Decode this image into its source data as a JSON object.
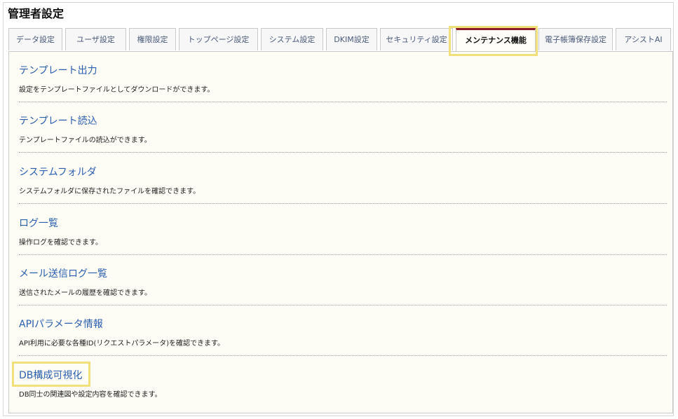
{
  "page": {
    "title": "管理者設定"
  },
  "tabs": [
    {
      "label": "データ設定"
    },
    {
      "label": "ユーザ設定"
    },
    {
      "label": "権限設定"
    },
    {
      "label": "トップページ設定"
    },
    {
      "label": "システム設定"
    },
    {
      "label": "DKIM設定"
    },
    {
      "label": "セキュリティ設定"
    },
    {
      "label": "メンテナンス機能"
    },
    {
      "label": "電子帳簿保存設定"
    },
    {
      "label": "アシストAI"
    }
  ],
  "active_tab": "メンテナンス機能",
  "items": [
    {
      "title": "テンプレート出力",
      "description": "設定をテンプレートファイルとしてダウンロードができます。"
    },
    {
      "title": "テンプレート読込",
      "description": "テンプレートファイルの読込ができます。"
    },
    {
      "title": "システムフォルダ",
      "description": "システムフォルダに保存されたファイルを確認できます。"
    },
    {
      "title": "ログ一覧",
      "description": "操作ログを確認できます。"
    },
    {
      "title": "メール送信ログ一覧",
      "description": "送信されたメールの履歴を確認できます。"
    },
    {
      "title": "APIパラメータ情報",
      "description": "API利用に必要な各種ID(リクエストパラメータ)を確認できます。"
    },
    {
      "title": "DB構成可視化",
      "description": "DB同士の関連図や設定内容を確認できます。"
    }
  ],
  "colors": {
    "accent": "#8b1a2a",
    "link": "#2a5fb0",
    "highlight": "#f2e07a",
    "panel_bg": "#fdfcf5"
  }
}
